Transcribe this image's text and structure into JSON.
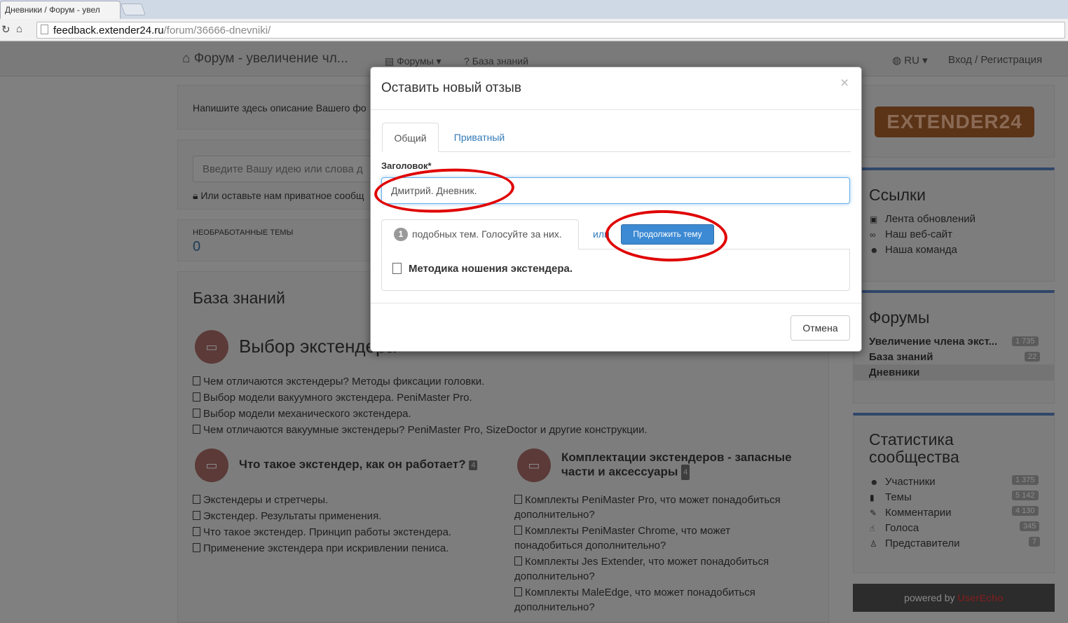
{
  "browser": {
    "tab_title": "Дневники / Форум - увел",
    "url_host": "feedback.extender24.ru",
    "url_path": "/forum/36666-dnevniki/"
  },
  "navbar": {
    "brand": "Форум - увеличение чл...",
    "forums": "Форумы",
    "knowledge_base": "База знаний",
    "language": "RU",
    "login": "Вход / Регистрация"
  },
  "main": {
    "description": "Напишите здесь описание Вашего фо",
    "search_placeholder": "Введите Вашу идею или слова д",
    "private_note": "Или оставьте нам приватное сообщ",
    "unprocessed_label": "НЕОБРАБОТАННЫЕ ТЕМЫ",
    "unprocessed_value": "0",
    "kb_title": "База знаний",
    "category1": {
      "title": "Выбор экстендера",
      "articles": [
        "Чем отличаются экстендеры? Методы фиксации головки.",
        "Выбор модели вакуумного экстендера. PeniMaster Pro.",
        "Выбор модели механического экстендера.",
        "Чем отличаются вакуумные экстендеры? PeniMaster Pro, SizeDoctor и другие конструкции."
      ]
    },
    "category2": {
      "title": "Что такое экстендер, как он работает?",
      "count": "4",
      "articles": [
        "Экстендеры и стретчеры.",
        "Экстендер. Результаты применения.",
        "Что такое экстендер. Принцип работы экстендера.",
        "Применение экстендера при искривлении пениса."
      ]
    },
    "category3": {
      "title": "Комплектации экстендеров - запасные части и аксессуары",
      "count": "4",
      "articles": [
        "Комплекты PeniMaster Pro, что может понадобиться дополнительно?",
        "Комплекты PeniMaster Chrome, что может понадобиться дополнительно?",
        "Комплекты Jes Extender, что может понадобиться дополнительно?",
        "Комплекты MaleEdge, что может понадобиться дополнительно?"
      ]
    }
  },
  "sidebar": {
    "logo_text": "EXTENDER24",
    "links_title": "Ссылки",
    "links": [
      "Лента обновлений",
      "Наш веб-сайт",
      "Наша команда"
    ],
    "forums_title": "Форумы",
    "forums": [
      {
        "name": "Увеличение члена экст...",
        "count": "1 735"
      },
      {
        "name": "База знаний",
        "count": "22"
      },
      {
        "name": "Дневники",
        "count": ""
      }
    ],
    "stats_title_1": "Статистика",
    "stats_title_2": "сообщества",
    "stats": [
      {
        "label": "Участники",
        "value": "1 375"
      },
      {
        "label": "Темы",
        "value": "5 142"
      },
      {
        "label": "Комментарии",
        "value": "4 130"
      },
      {
        "label": "Голоса",
        "value": "345"
      },
      {
        "label": "Представители",
        "value": "7"
      }
    ],
    "powered_prefix": "powered by",
    "powered_brand": "UserEcho"
  },
  "modal": {
    "title": "Оставить новый отзыв",
    "close": "×",
    "tab_general": "Общий",
    "tab_private": "Приватный",
    "title_label": "Заголовок*",
    "title_value": "Дмитрий. Дневник.",
    "similar_count": "1",
    "similar_text": "подобных тем. Голосуйте за них.",
    "or_text": "или",
    "continue_button": "Продолжить тему",
    "similar_topic": "Методика ношения экстендера.",
    "cancel_button": "Отмена"
  },
  "colors": {
    "primary": "#3c8ad3",
    "link": "#337ab7",
    "annotation": "#e00000",
    "overlay": "#808080"
  }
}
